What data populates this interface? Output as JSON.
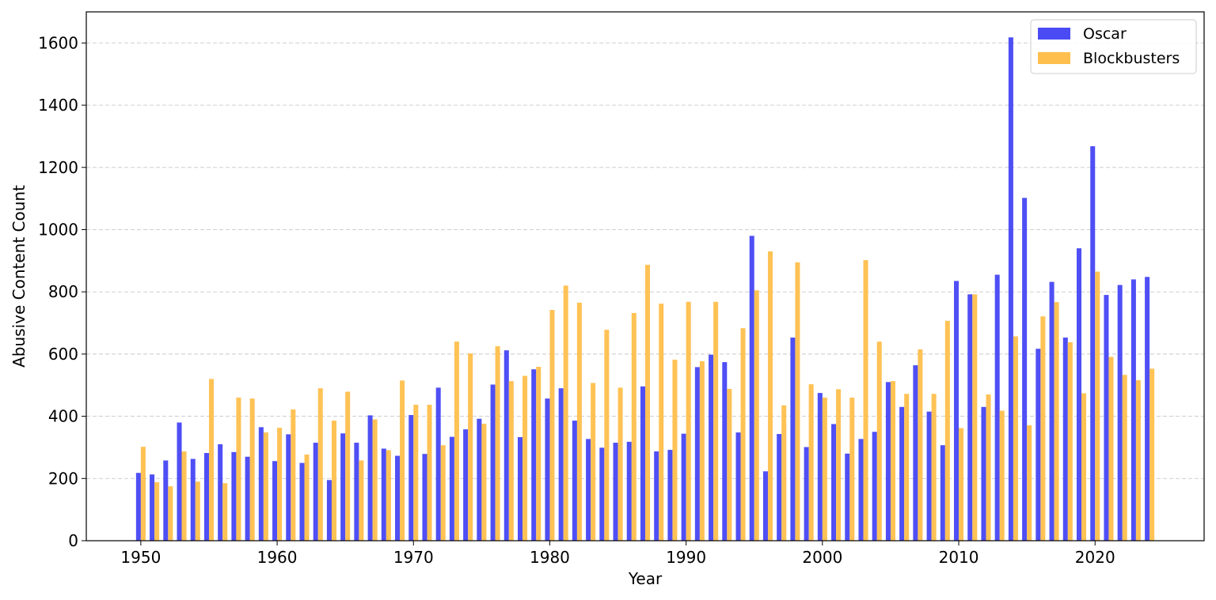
{
  "chart_data": {
    "type": "bar",
    "title": "",
    "xlabel": "Year",
    "ylabel": "Abusive Content Count",
    "xlim": [
      1946,
      2028
    ],
    "ylim": [
      0,
      1700
    ],
    "xticks": [
      1950,
      1960,
      1970,
      1980,
      1990,
      2000,
      2010,
      2020
    ],
    "yticks": [
      0,
      200,
      400,
      600,
      800,
      1000,
      1200,
      1400,
      1600
    ],
    "grid": "y-dashed",
    "legend": "top-right",
    "x": [
      1950,
      1951,
      1952,
      1953,
      1954,
      1955,
      1956,
      1957,
      1958,
      1959,
      1960,
      1961,
      1962,
      1963,
      1964,
      1965,
      1966,
      1967,
      1968,
      1969,
      1970,
      1971,
      1972,
      1973,
      1974,
      1975,
      1976,
      1977,
      1978,
      1979,
      1980,
      1981,
      1982,
      1983,
      1984,
      1985,
      1986,
      1987,
      1988,
      1989,
      1990,
      1991,
      1992,
      1993,
      1994,
      1995,
      1996,
      1997,
      1998,
      1999,
      2000,
      2001,
      2002,
      2003,
      2004,
      2005,
      2006,
      2007,
      2008,
      2009,
      2010,
      2011,
      2012,
      2013,
      2014,
      2015,
      2016,
      2017,
      2018,
      2019,
      2020,
      2021,
      2022,
      2023,
      2024
    ],
    "series": [
      {
        "name": "Oscar",
        "color": "#4b4bf5",
        "values": [
          218,
          213,
          258,
          380,
          263,
          282,
          310,
          285,
          270,
          365,
          256,
          342,
          250,
          315,
          195,
          345,
          315,
          403,
          296,
          273,
          404,
          279,
          492,
          334,
          358,
          392,
          502,
          612,
          333,
          551,
          457,
          490,
          386,
          327,
          299,
          315,
          318,
          496,
          287,
          292,
          344,
          558,
          598,
          574,
          348,
          980,
          223,
          343,
          653,
          301,
          475,
          375,
          280,
          327,
          350,
          510,
          430,
          564,
          415,
          307,
          835,
          792,
          430,
          855,
          1618,
          1102,
          617,
          832,
          653,
          940,
          1268,
          790,
          822,
          840,
          848
        ]
      },
      {
        "name": "Blockbusters",
        "color": "#ffbf4c",
        "values": [
          302,
          188,
          175,
          287,
          190,
          520,
          185,
          460,
          457,
          348,
          363,
          422,
          277,
          490,
          386,
          479,
          258,
          390,
          291,
          515,
          437,
          437,
          307,
          640,
          602,
          376,
          625,
          513,
          530,
          559,
          742,
          820,
          765,
          507,
          678,
          492,
          732,
          887,
          762,
          582,
          768,
          577,
          768,
          488,
          683,
          805,
          930,
          435,
          895,
          503,
          460,
          487,
          460,
          902,
          640,
          513,
          472,
          615,
          472,
          707,
          362,
          792,
          470,
          418,
          657,
          371,
          721,
          767,
          638,
          474,
          865,
          591,
          533,
          516,
          553
        ]
      }
    ]
  }
}
